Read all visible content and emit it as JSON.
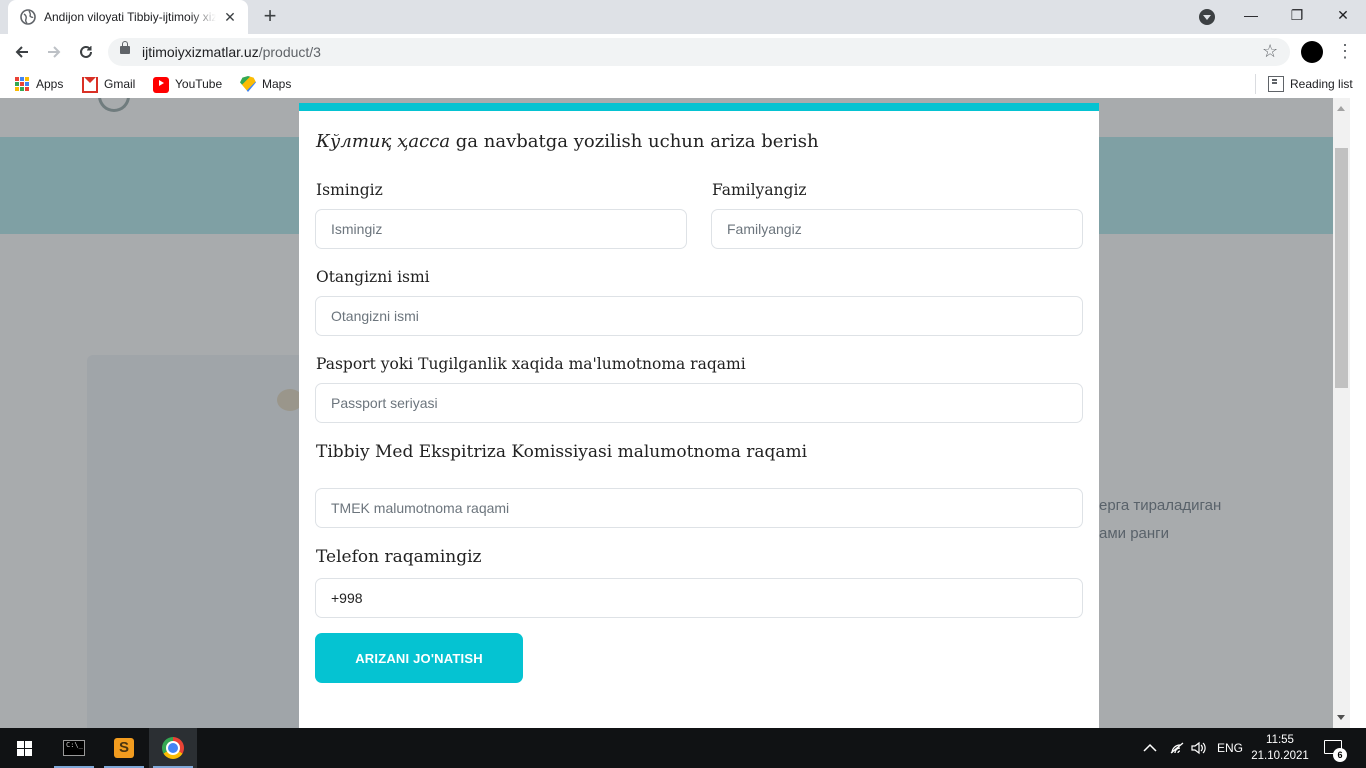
{
  "browser": {
    "tab_title": "Andijon viloyati Tibbiy-ijtimoiy xizmatlar",
    "tab_close": "✕",
    "new_tab": "+",
    "window_controls": {
      "minimize": "—",
      "restore": "❐",
      "close": "✕"
    },
    "url_domain": "ijtimoiyxizmatlar.uz",
    "url_path": "/product/3",
    "bookmarks": [
      {
        "label": "Apps",
        "icon": "apps-grid-icon"
      },
      {
        "label": "Gmail",
        "icon": "gmail-icon"
      },
      {
        "label": "YouTube",
        "icon": "youtube-icon"
      },
      {
        "label": "Maps",
        "icon": "maps-icon"
      }
    ],
    "reading_list": "Reading list"
  },
  "background": {
    "text_line_1": "ерга тираладиган",
    "text_line_2": "ами ранги"
  },
  "modal": {
    "title_service": "Кўлтиқ ҳасса",
    "title_rest": " ga navbatga yozilish uchun ariza berish",
    "fields": {
      "first_name": {
        "label": "Ismingiz",
        "placeholder": "Ismingiz"
      },
      "last_name": {
        "label": "Familyangiz",
        "placeholder": "Familyangiz"
      },
      "patronymic": {
        "label": "Otangizni ismi",
        "placeholder": "Otangizni ismi"
      },
      "passport": {
        "label": "Pasport yoki Tugilganlik xaqida ma'lumotnoma raqami",
        "placeholder": "Passport seriyasi"
      },
      "tmek": {
        "label": "Tibbiy Med Ekspitriza Komissiyasi malumotnoma raqami",
        "placeholder": "TMEK malumotnoma raqami"
      },
      "phone": {
        "label": "Telefon raqamingiz",
        "value": "+998"
      }
    },
    "submit_label": "ARIZANI JO'NATISH"
  },
  "taskbar": {
    "language": "ENG",
    "time": "11:55",
    "date": "21.10.2021",
    "notifications_count": "6"
  },
  "colors": {
    "accent": "#05c3d2",
    "hero_background": "#b5ebef",
    "tab_strip": "#dee1e6",
    "taskbar": "#101214"
  }
}
